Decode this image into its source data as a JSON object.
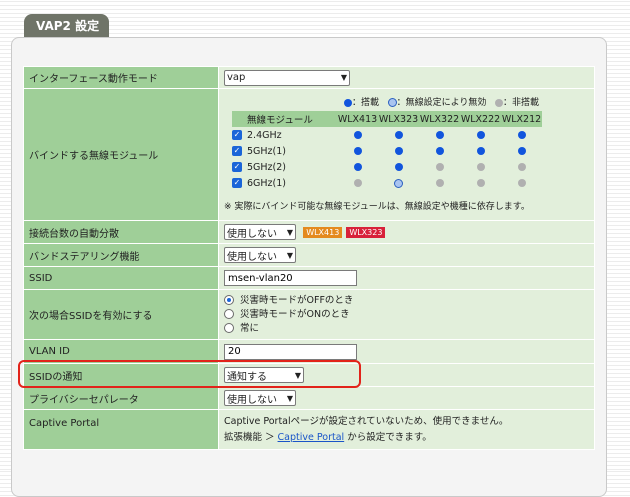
{
  "tab_title": "VAP2 設定",
  "colors": {
    "tab_bg": "#6f7468",
    "label_bg": "#9fcf98",
    "value_bg": "#e2efdb",
    "highlight": "#e2231a",
    "wlx413_badge": "#e48a1e",
    "wlx323_badge": "#d8213a"
  },
  "rows": {
    "interface_mode": {
      "label": "インターフェース動作モード",
      "value": "vap"
    },
    "bind_module": {
      "label": "バインドする無線モジュール",
      "legend": {
        "mounted": "：搭載",
        "disabled_by_setting": "：無線設定により無効",
        "not_mounted": "：非搭載"
      },
      "header": [
        "無線モジュール",
        "WLX413",
        "WLX323",
        "WLX322",
        "WLX222",
        "WLX212"
      ],
      "modules": [
        {
          "name": "2.4GHz",
          "status": [
            "mounted",
            "mounted",
            "mounted",
            "mounted",
            "mounted"
          ]
        },
        {
          "name": "5GHz(1)",
          "status": [
            "mounted",
            "mounted",
            "mounted",
            "mounted",
            "mounted"
          ]
        },
        {
          "name": "5GHz(2)",
          "status": [
            "mounted",
            "mounted",
            "not_mounted",
            "not_mounted",
            "not_mounted"
          ]
        },
        {
          "name": "6GHz(1)",
          "status": [
            "not_mounted",
            "disabled_by_setting",
            "not_mounted",
            "not_mounted",
            "not_mounted"
          ]
        }
      ],
      "note": "※ 実際にバインド可能な無線モジュールは、無線設定や機種に依存します。"
    },
    "auto_distribution": {
      "label": "接続台数の自動分散",
      "value": "使用しない",
      "badges": [
        "WLX413",
        "WLX323"
      ]
    },
    "band_steering": {
      "label": "バンドステアリング機能",
      "value": "使用しない"
    },
    "ssid": {
      "label": "SSID",
      "value": "msen-vlan20"
    },
    "ssid_enable": {
      "label": "次の場合SSIDを有効にする",
      "options": [
        "災害時モードがOFFのとき",
        "災害時モードがONのとき",
        "常に"
      ],
      "selected": 0
    },
    "vlan_id": {
      "label": "VLAN ID",
      "value": "20"
    },
    "ssid_notify": {
      "label": "SSIDの通知",
      "value": "通知する"
    },
    "privacy_separator": {
      "label": "プライバシーセパレータ",
      "value": "使用しない"
    },
    "captive_portal": {
      "label": "Captive Portal",
      "line1": "Captive Portalページが設定されていないため、使用できません。",
      "line2_pre": "拡張機能 ＞ ",
      "line2_link": "Captive Portal",
      "line2_post": " から設定できます。"
    }
  }
}
